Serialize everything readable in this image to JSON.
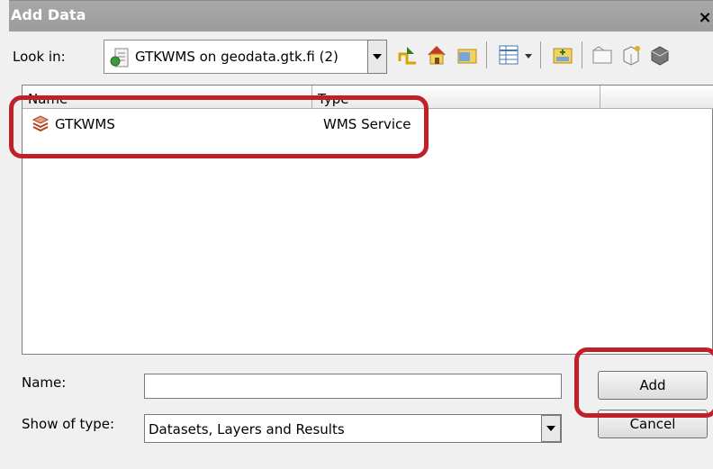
{
  "window": {
    "title": "Add Data",
    "close_label": "×"
  },
  "lookin": {
    "label": "Look in:",
    "current": "GTKWMS on geodata.gtk.fi (2)",
    "icon": "wms-connection-icon"
  },
  "toolbar": {
    "icons": [
      "up-one-level-icon",
      "home-icon",
      "connect-to-folder-icon",
      "view-options-icon",
      "add-connection-icon",
      "new-folder-icon",
      "new-item-icon",
      "catalog-icon"
    ]
  },
  "filelist": {
    "columns": [
      "Name",
      "Type"
    ],
    "rows": [
      {
        "name": "GTKWMS",
        "type": "WMS Service",
        "icon": "wms-service-icon"
      }
    ]
  },
  "name_field": {
    "label": "Name:",
    "value": ""
  },
  "type_filter": {
    "label": "Show of type:",
    "value": "Datasets, Layers and Results"
  },
  "buttons": {
    "add": "Add",
    "cancel": "Cancel"
  },
  "colors": {
    "highlight": "#c0202a"
  }
}
